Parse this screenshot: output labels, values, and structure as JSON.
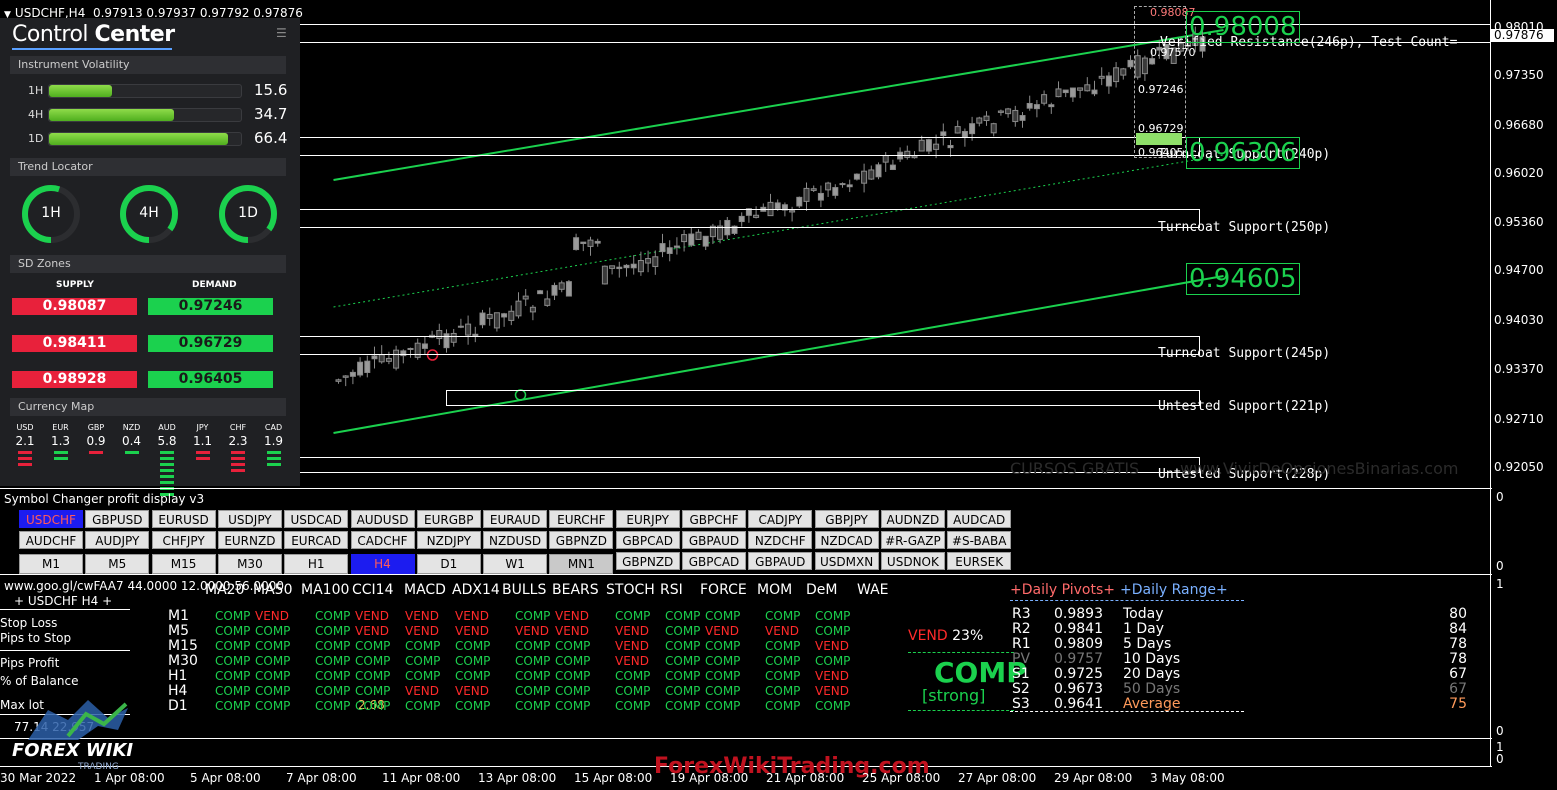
{
  "title_bar": {
    "symbol": "USDCHF,H4",
    "ohlc": "0.97913 0.97937 0.97792 0.97876"
  },
  "price_axis": {
    "current": "0.97876",
    "ticks": [
      "0.98010",
      "0.97350",
      "0.96680",
      "0.96020",
      "0.95360",
      "0.94700",
      "0.94030",
      "0.93370",
      "0.92710",
      "0.92050"
    ]
  },
  "control_center": {
    "title_light": "Control",
    "title_bold": "Center",
    "menu_icon": "hamburger-icon",
    "volatility": {
      "heading": "Instrument Volatility",
      "rows": [
        {
          "tf": "1H",
          "value": "15.6",
          "fill": 0.33
        },
        {
          "tf": "4H",
          "value": "34.7",
          "fill": 0.65
        },
        {
          "tf": "1D",
          "value": "66.4",
          "fill": 0.93
        }
      ]
    },
    "trend": {
      "heading": "Trend Locator",
      "gauges": [
        {
          "tf": "1H",
          "level": 0.55
        },
        {
          "tf": "4H",
          "level": 0.85
        },
        {
          "tf": "1D",
          "level": 0.85
        }
      ]
    },
    "sd_zones": {
      "heading": "SD Zones",
      "supply_label": "SUPPLY",
      "demand_label": "DEMAND",
      "supply": [
        "0.98087",
        "0.98411",
        "0.98928"
      ],
      "demand": [
        "0.97246",
        "0.96729",
        "0.96405"
      ]
    },
    "currency_map": {
      "heading": "Currency Map",
      "items": [
        {
          "code": "USD",
          "value": "2.1",
          "color": "#e8213b",
          "bars": 3
        },
        {
          "code": "EUR",
          "value": "1.3",
          "color": "#1bd14e",
          "bars": 2
        },
        {
          "code": "GBP",
          "value": "0.9",
          "color": "#e8213b",
          "bars": 1
        },
        {
          "code": "NZD",
          "value": "0.4",
          "color": "#1bd14e",
          "bars": 1
        },
        {
          "code": "AUD",
          "value": "5.8",
          "color": "#1bd14e",
          "bars": 8
        },
        {
          "code": "JPY",
          "value": "1.1",
          "color": "#e8213b",
          "bars": 2
        },
        {
          "code": "CHF",
          "value": "2.3",
          "color": "#e8213b",
          "bars": 4
        },
        {
          "code": "CAD",
          "value": "1.9",
          "color": "#1bd14e",
          "bars": 3
        }
      ]
    }
  },
  "zones": [
    "Verified Resistance(246p), Test Count=",
    "Turncoat Support(240p)",
    "Turncoat Support(250p)",
    "Turncoat Support(245p)",
    "Untested Support(221p)",
    "Untested Support(228p)"
  ],
  "big_prices": [
    "0.98008",
    "0.96306",
    "0.94605"
  ],
  "small_prices": [
    "0.98087",
    "0.97570",
    "0.97246",
    "0.96729",
    "0.96405"
  ],
  "watermark": {
    "left": "CURSOS GRATIS",
    "right": "www.VivirDeOpcionesBinarias.com"
  },
  "symbol_changer": {
    "title": "Symbol Changer profit display v3",
    "row1": [
      "USDCHF",
      "GBPUSD",
      "EURUSD",
      "USDJPY",
      "USDCAD",
      "AUDUSD",
      "EURGBP",
      "EURAUD",
      "EURCHF",
      "EURJPY",
      "GBPCHF",
      "CADJPY",
      "GBPJPY",
      "AUDNZD",
      "AUDCAD"
    ],
    "row2": [
      "AUDCHF",
      "AUDJPY",
      "CHFJPY",
      "EURNZD",
      "EURCAD",
      "CADCHF",
      "NZDJPY",
      "NZDUSD",
      "GBPNZD",
      "GBPCAD",
      "GBPAUD",
      "NZDCHF",
      "NZDCAD",
      "#R-GAZP",
      "#S-BABA"
    ],
    "row3_tf": [
      "M1",
      "M5",
      "M15",
      "M30",
      "H1",
      "H4",
      "D1",
      "W1",
      "MN1"
    ],
    "row3_sym": [
      "GBPNZD",
      "GBPCAD",
      "GBPAUD",
      "USDMXN",
      "USDNOK",
      "EURSEK"
    ]
  },
  "dashboard": {
    "url_line": "www.goo.gl/cwFAA7 44.0000 12.0000 56.0000",
    "symbol_line": "+  USDCHF  H4  +",
    "labels": [
      "Stop Loss",
      "Pips to Stop",
      "Pips Profit",
      "% of Balance",
      "Max lot"
    ],
    "max_lot_value": "2.68",
    "bottom_value": "77.14   22.957",
    "indicators": [
      "MA20",
      "MA50",
      "MA100",
      "CCI14",
      "MACD",
      "ADX14",
      "BULLS",
      "BEARS",
      "STOCH",
      "RSI",
      "FORCE",
      "MOM",
      "DeM",
      "WAE"
    ],
    "timeframes": [
      "M1",
      "M5",
      "M15",
      "M30",
      "H1",
      "H4",
      "D1"
    ],
    "signals": [
      [
        "COMP",
        "VEND",
        "COMP",
        "VEND",
        "VEND",
        "VEND",
        "COMP",
        "VEND",
        "COMP",
        "COMP",
        "COMP",
        "COMP",
        "COMP"
      ],
      [
        "COMP",
        "COMP",
        "COMP",
        "VEND",
        "VEND",
        "VEND",
        "VEND",
        "VEND",
        "VEND",
        "COMP",
        "VEND",
        "VEND",
        "COMP"
      ],
      [
        "COMP",
        "COMP",
        "COMP",
        "COMP",
        "COMP",
        "COMP",
        "COMP",
        "COMP",
        "VEND",
        "COMP",
        "COMP",
        "COMP",
        "VEND"
      ],
      [
        "COMP",
        "COMP",
        "COMP",
        "COMP",
        "COMP",
        "COMP",
        "COMP",
        "COMP",
        "VEND",
        "COMP",
        "COMP",
        "COMP",
        "COMP"
      ],
      [
        "COMP",
        "COMP",
        "COMP",
        "COMP",
        "COMP",
        "COMP",
        "COMP",
        "COMP",
        "COMP",
        "COMP",
        "COMP",
        "COMP",
        "VEND"
      ],
      [
        "COMP",
        "COMP",
        "COMP",
        "COMP",
        "VEND",
        "VEND",
        "COMP",
        "COMP",
        "COMP",
        "COMP",
        "COMP",
        "COMP",
        "VEND"
      ],
      [
        "COMP",
        "COMP",
        "COMP",
        "COMP",
        "COMP",
        "COMP",
        "COMP",
        "COMP",
        "COMP",
        "COMP",
        "COMP",
        "COMP",
        "COMP"
      ]
    ],
    "summary": {
      "vend_label": "VEND",
      "vend_pct": "23%",
      "verdict": "COMP",
      "strength": "[strong]"
    },
    "pivots": {
      "heading": "+Daily Pivots+",
      "rows": [
        {
          "name": "R3",
          "value": "0.9893"
        },
        {
          "name": "R2",
          "value": "0.9841"
        },
        {
          "name": "R1",
          "value": "0.9809"
        },
        {
          "name": "PV",
          "value": "0.9757"
        },
        {
          "name": "S1",
          "value": "0.9725"
        },
        {
          "name": "S2",
          "value": "0.9673"
        },
        {
          "name": "S3",
          "value": "0.9641"
        }
      ]
    },
    "range": {
      "heading": "+Daily Range+",
      "rows": [
        {
          "name": "Today",
          "value": "80"
        },
        {
          "name": "1 Day",
          "value": "84"
        },
        {
          "name": "5 Days",
          "value": "78"
        },
        {
          "name": "10 Days",
          "value": "78"
        },
        {
          "name": "20 Days",
          "value": "67"
        },
        {
          "name": "50 Days",
          "value": "67"
        },
        {
          "name": "Average",
          "value": "75"
        }
      ]
    }
  },
  "sub_axis": [
    "0",
    "1",
    "0",
    "1",
    "0"
  ],
  "logo": {
    "brand": "FOREX WIKI",
    "sub": "TRADING"
  },
  "footer_brand": "ForexWikiTrading.com",
  "dates": [
    "30 Mar 2022",
    "1 Apr 08:00",
    "5 Apr 08:00",
    "7 Apr 08:00",
    "11 Apr 08:00",
    "13 Apr 08:00",
    "15 Apr 08:00",
    "19 Apr 08:00",
    "21 Apr 08:00",
    "25 Apr 08:00",
    "27 Apr 08:00",
    "29 Apr 08:00",
    "3 May 08:00"
  ]
}
